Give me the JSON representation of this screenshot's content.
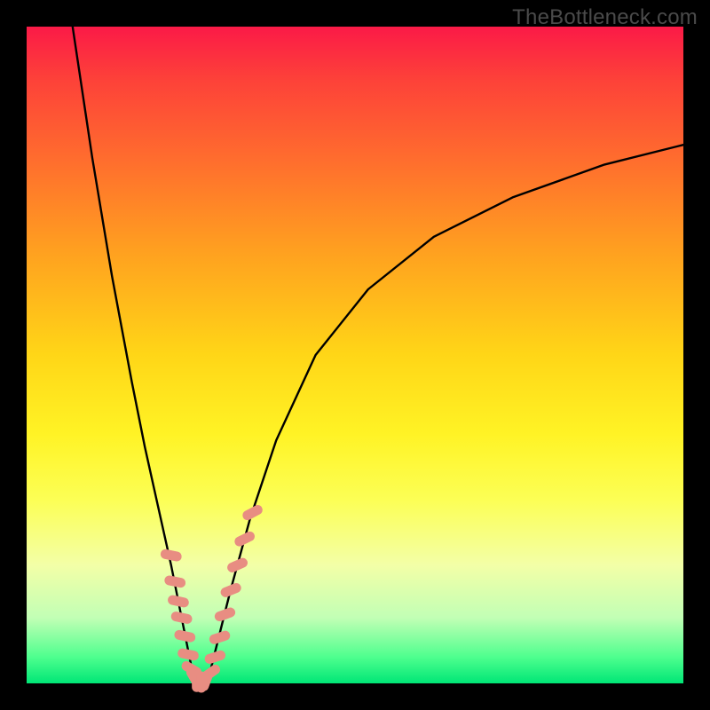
{
  "watermark": "TheBottleneck.com",
  "chart_data": {
    "type": "line",
    "title": "",
    "xlabel": "",
    "ylabel": "",
    "xlim": [
      0,
      100
    ],
    "ylim": [
      0,
      100
    ],
    "grid": false,
    "legend": false,
    "series": [
      {
        "name": "left-branch",
        "x": [
          7,
          10,
          13,
          16,
          18,
          20,
          22,
          23,
          24,
          25,
          25.7
        ],
        "y": [
          100,
          80,
          62,
          46,
          36,
          27,
          18,
          13,
          8,
          3,
          0
        ],
        "color": "#000000"
      },
      {
        "name": "right-branch",
        "x": [
          27.5,
          29,
          31,
          34,
          38,
          44,
          52,
          62,
          74,
          88,
          100
        ],
        "y": [
          0,
          6,
          14,
          25,
          37,
          50,
          60,
          68,
          74,
          79,
          82
        ],
        "color": "#000000"
      },
      {
        "name": "bottom-flat",
        "x": [
          25.7,
          27.5
        ],
        "y": [
          0,
          0
        ],
        "color": "#000000"
      }
    ],
    "markers": {
      "name": "highlight-dashes",
      "color": "#e88d82",
      "points": [
        {
          "x": 22.0,
          "y": 19.5,
          "angle": -78
        },
        {
          "x": 22.6,
          "y": 15.5,
          "angle": -78
        },
        {
          "x": 23.1,
          "y": 12.5,
          "angle": -78
        },
        {
          "x": 23.6,
          "y": 10.0,
          "angle": -78
        },
        {
          "x": 24.1,
          "y": 7.2,
          "angle": -78
        },
        {
          "x": 24.6,
          "y": 4.4,
          "angle": -78
        },
        {
          "x": 25.1,
          "y": 2.2,
          "angle": -60
        },
        {
          "x": 25.5,
          "y": 0.9,
          "angle": -30
        },
        {
          "x": 25.9,
          "y": 0.3,
          "angle": 0
        },
        {
          "x": 26.6,
          "y": 0.2,
          "angle": 0
        },
        {
          "x": 27.3,
          "y": 0.4,
          "angle": 20
        },
        {
          "x": 28.0,
          "y": 1.6,
          "angle": 55
        },
        {
          "x": 28.7,
          "y": 4.0,
          "angle": 72
        },
        {
          "x": 29.4,
          "y": 7.0,
          "angle": 72
        },
        {
          "x": 30.2,
          "y": 10.5,
          "angle": 70
        },
        {
          "x": 31.1,
          "y": 14.2,
          "angle": 68
        },
        {
          "x": 32.1,
          "y": 18.0,
          "angle": 66
        },
        {
          "x": 33.2,
          "y": 22.0,
          "angle": 64
        },
        {
          "x": 34.4,
          "y": 26.0,
          "angle": 62
        }
      ]
    },
    "gradient_stops": [
      {
        "pos": 0.0,
        "color": "#fb1a47"
      },
      {
        "pos": 0.08,
        "color": "#fd4139"
      },
      {
        "pos": 0.2,
        "color": "#ff6c2e"
      },
      {
        "pos": 0.35,
        "color": "#ffa31f"
      },
      {
        "pos": 0.5,
        "color": "#ffd617"
      },
      {
        "pos": 0.62,
        "color": "#fff325"
      },
      {
        "pos": 0.72,
        "color": "#fcff55"
      },
      {
        "pos": 0.82,
        "color": "#f3ffa7"
      },
      {
        "pos": 0.9,
        "color": "#c2ffb5"
      },
      {
        "pos": 0.96,
        "color": "#4eff8e"
      },
      {
        "pos": 1.0,
        "color": "#00e676"
      }
    ]
  }
}
